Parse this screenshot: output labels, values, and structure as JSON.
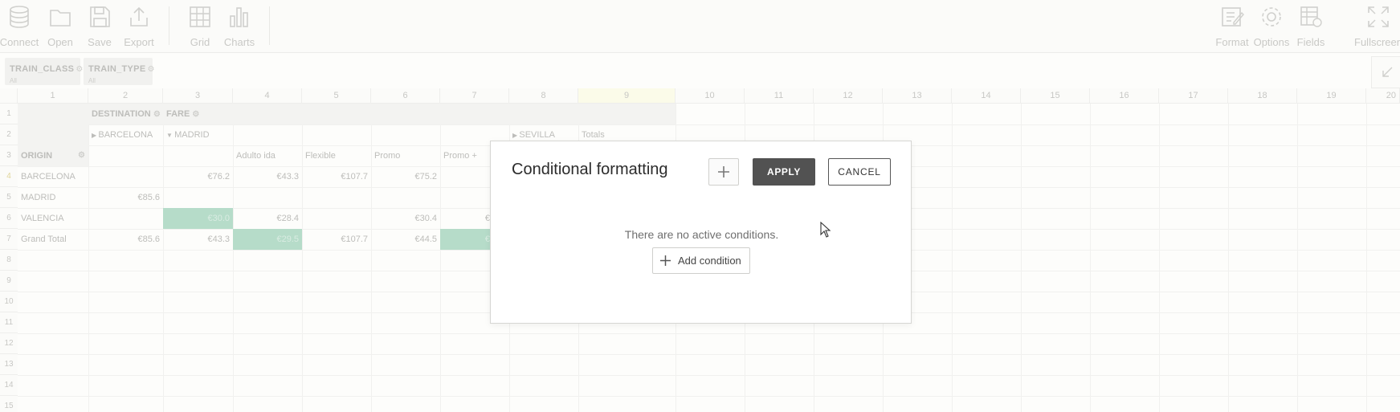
{
  "toolbar": {
    "left": [
      {
        "label": "Connect",
        "icon": "database-icon"
      },
      {
        "label": "Open",
        "icon": "folder-icon"
      },
      {
        "label": "Save",
        "icon": "save-icon"
      },
      {
        "label": "Export",
        "icon": "export-icon"
      },
      {
        "label": "Grid",
        "icon": "grid-icon"
      },
      {
        "label": "Charts",
        "icon": "bar-chart-icon"
      }
    ],
    "right": [
      {
        "label": "Format",
        "icon": "format-icon"
      },
      {
        "label": "Options",
        "icon": "gear-icon"
      },
      {
        "label": "Fields",
        "icon": "fields-icon"
      },
      {
        "label": "Fullscreen",
        "icon": "fullscreen-icon"
      }
    ]
  },
  "filters": [
    {
      "name": "TRAIN_CLASS",
      "sub": "All"
    },
    {
      "name": "TRAIN_TYPE",
      "sub": "All"
    }
  ],
  "grid": {
    "columns": [
      "1",
      "2",
      "3",
      "4",
      "5",
      "6",
      "7",
      "8",
      "9",
      "10",
      "11",
      "12",
      "13",
      "14",
      "15",
      "16",
      "17",
      "18",
      "19",
      "20"
    ],
    "rows": [
      "1",
      "2",
      "3",
      "4",
      "5",
      "6",
      "7",
      "8",
      "9",
      "10",
      "11",
      "12",
      "13",
      "14",
      "15"
    ],
    "selected_column": "9",
    "selected_row": "4",
    "headers": {
      "destination": "DESTINATION",
      "fare": "FARE",
      "barcelona": "BARCELONA",
      "madrid": "MADRID",
      "sevilla": "SEVILLA",
      "totals": "Totals",
      "origin": "ORIGIN",
      "fares": [
        "Adulto ida",
        "Flexible",
        "Promo",
        "Promo +"
      ]
    },
    "body": [
      {
        "origin": "BARCELONA",
        "values": [
          "",
          "€76.2",
          "€43.3",
          "€107.7",
          "€75.2",
          ""
        ]
      },
      {
        "origin": "MADRID",
        "values": [
          "€85.6",
          "",
          "",
          "",
          "",
          ""
        ]
      },
      {
        "origin": "VALENCIA",
        "values": [
          "",
          "€30.0",
          "€28.4",
          "",
          "€30.4",
          "€"
        ]
      },
      {
        "origin": "Grand Total",
        "values": [
          "€85.6",
          "€43.3",
          "€29.5",
          "€107.7",
          "€44.5",
          "€"
        ]
      }
    ],
    "highlight_color": "#b6dcc9"
  },
  "modal": {
    "title": "Conditional formatting",
    "apply_label": "APPLY",
    "cancel_label": "CANCEL",
    "empty_message": "There are no active conditions.",
    "add_condition_label": "Add condition"
  }
}
